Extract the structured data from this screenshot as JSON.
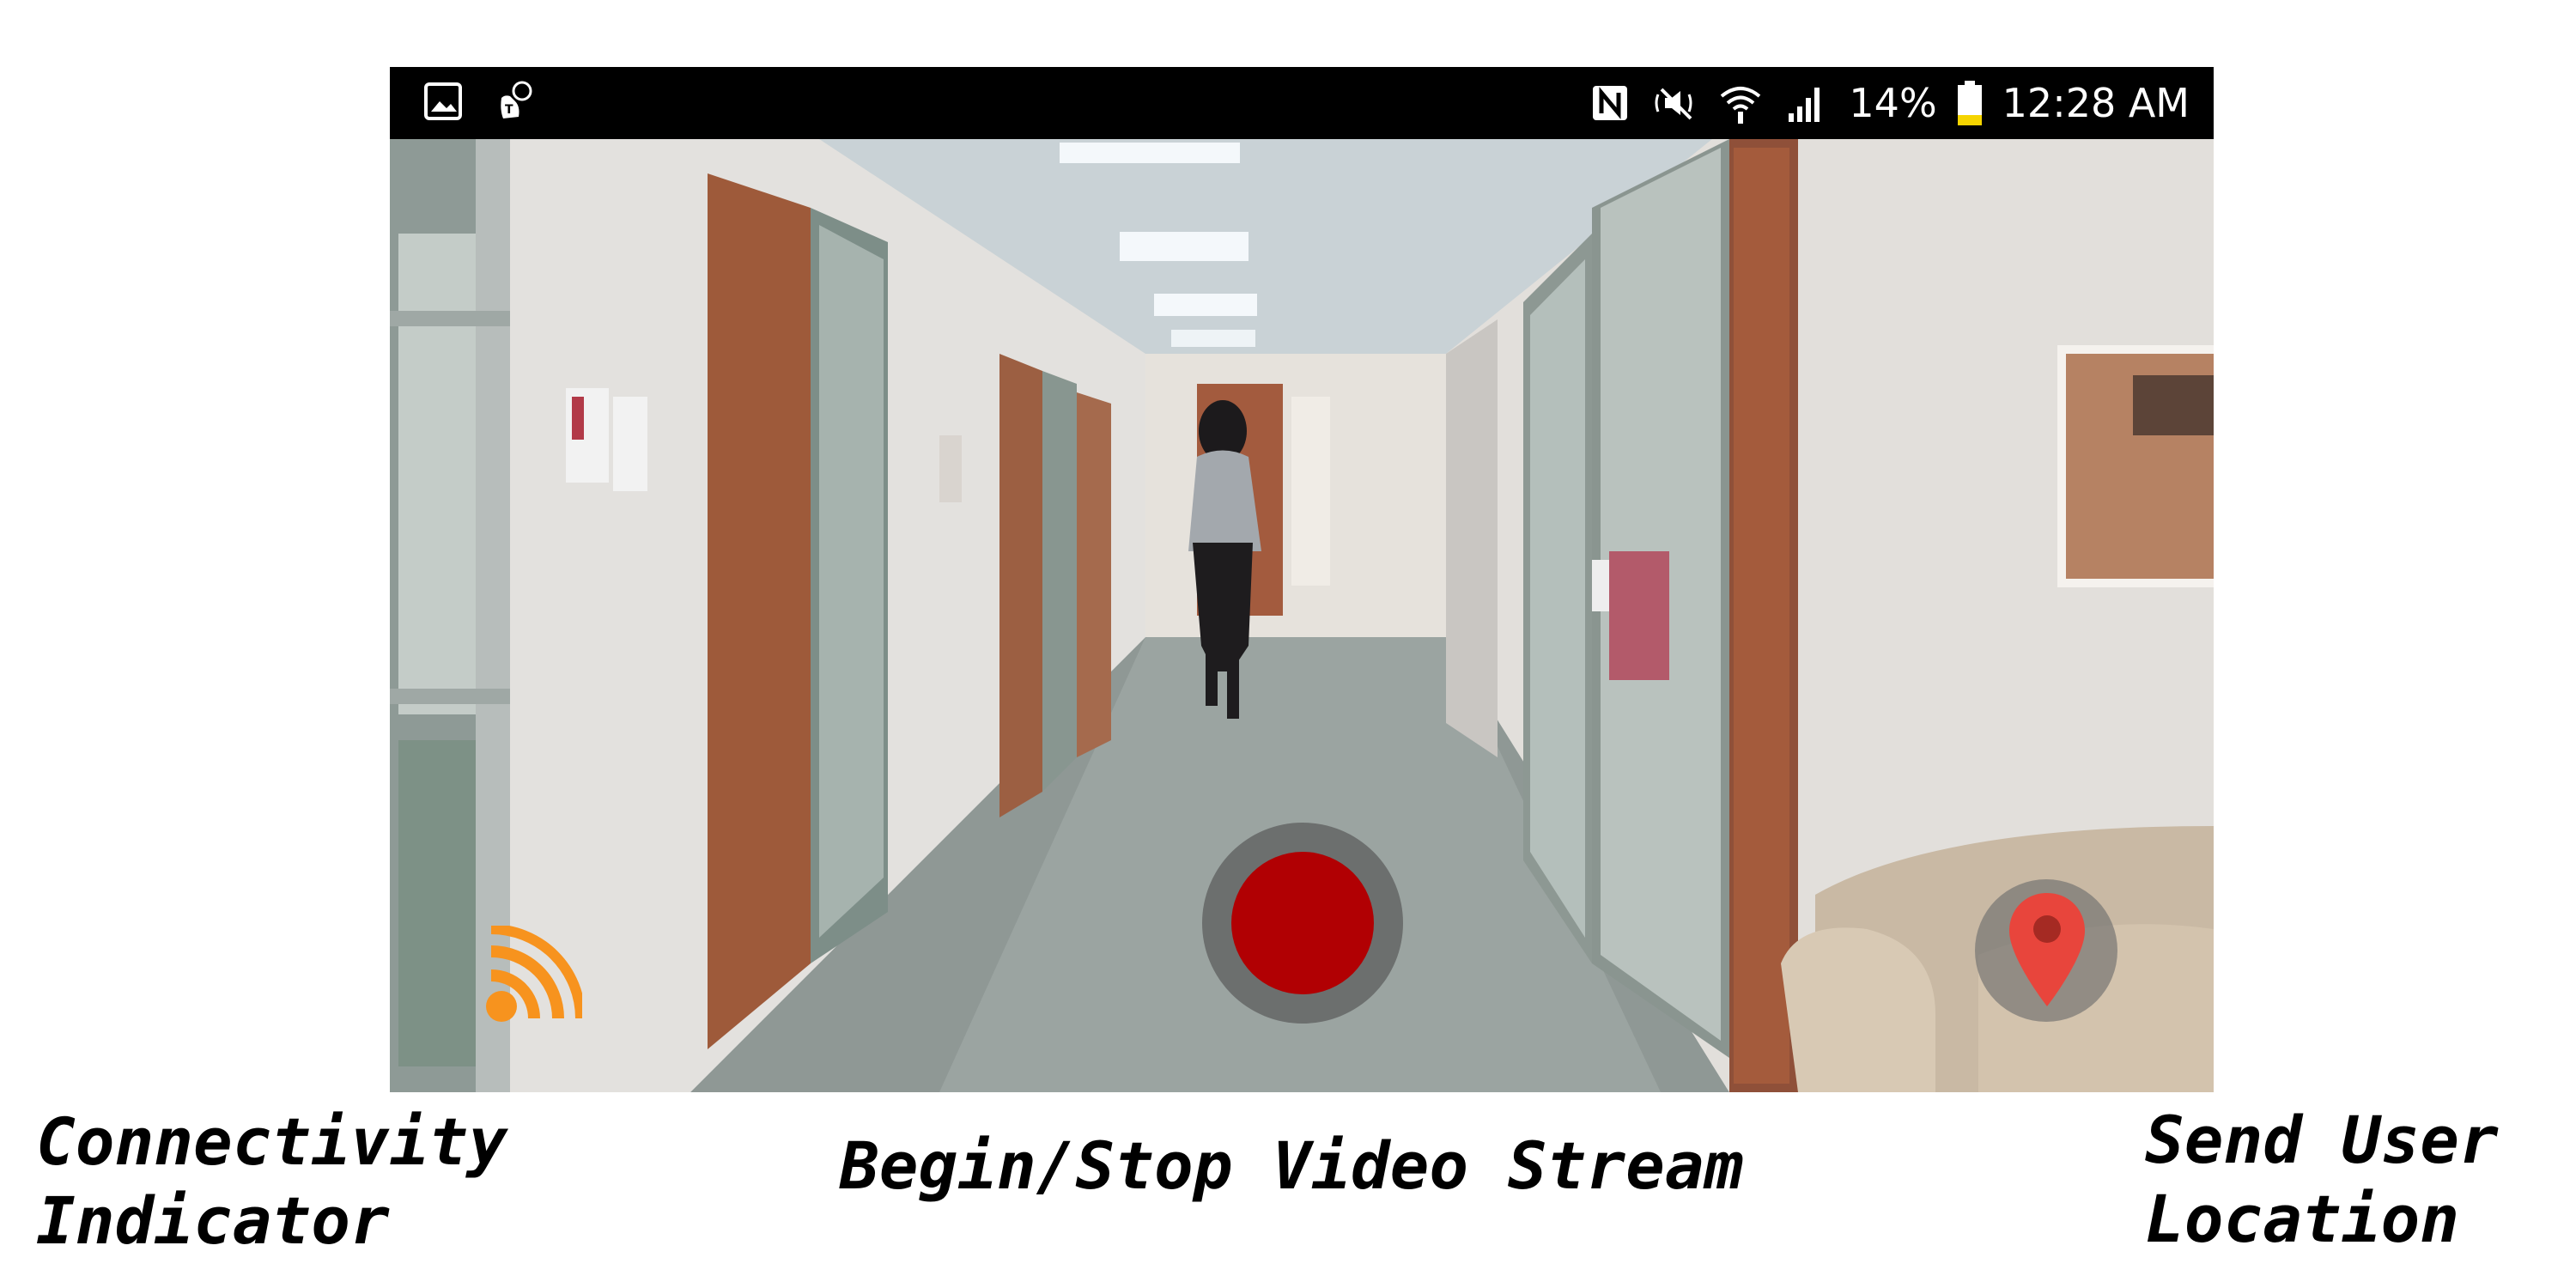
{
  "status_bar": {
    "left_icons": [
      "gallery-icon",
      "tmobile-icon"
    ],
    "right_icons": [
      "nfc-icon",
      "mute-icon",
      "wifi-icon",
      "signal-icon",
      "battery-icon"
    ],
    "battery_percent": "14%",
    "time": "12:28 AM",
    "battery_color": "#f5d400"
  },
  "camera": {
    "scene": "hallway-camera-feed"
  },
  "controls": {
    "record_button_icon": "record-icon",
    "record_color": "#b10003",
    "location_button_icon": "map-pin-icon",
    "location_color": "#e8453c",
    "connectivity_icon": "rss-icon",
    "connectivity_color": "#f7931e"
  },
  "captions": {
    "connectivity": [
      "Connectivity",
      "Indicator"
    ],
    "video": "Begin/Stop Video Stream",
    "location": [
      "Send User",
      "Location"
    ]
  }
}
